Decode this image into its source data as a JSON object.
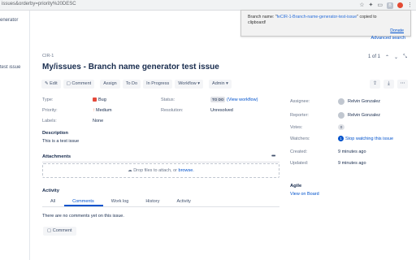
{
  "browser": {
    "url": "issues&orderby=priority%20DESC",
    "ext_icons": [
      "star-icon",
      "extensions-icon",
      "cast-icon",
      "branch-extension-icon",
      "red-extension-icon",
      "menu-icon"
    ]
  },
  "sidebar_partial": {
    "app_name": "enerator",
    "selected_issue": "test issue"
  },
  "popup": {
    "message_prefix": "Branch name: \"",
    "branch_name": "feCIR-1-Branch-name-generator-test-issue",
    "message_suffix": "\" copied to clipboard!",
    "donate": "Donate"
  },
  "header": {
    "advanced_search": "Advanced search",
    "breadcrumb": "CIR-1",
    "pager": "1 of 1",
    "title": "My/issues - Branch name generator test issue"
  },
  "toolbar": {
    "edit": "Edit",
    "comment": "Comment",
    "assign": "Assign",
    "todo": "To Do",
    "in_progress": "In Progress",
    "workflow": "Workflow",
    "admin": "Admin"
  },
  "details": {
    "type_label": "Type:",
    "type_value": "Bug",
    "priority_label": "Priority:",
    "priority_value": "Medium",
    "labels_label": "Labels:",
    "labels_value": "None",
    "status_label": "Status:",
    "status_value": "TO DO",
    "status_link": "(View workflow)",
    "resolution_label": "Resolution:",
    "resolution_value": "Unresolved"
  },
  "people": {
    "assignee_label": "Assignee:",
    "assignee": "Relvin Gonzalez",
    "reporter_label": "Reporter:",
    "reporter": "Relvin Gonzalez",
    "votes_label": "Votes:",
    "votes": "0",
    "watchers_label": "Watchers:",
    "watchers_count": "1",
    "watch_link": "Stop watching this issue"
  },
  "dates": {
    "created_label": "Created:",
    "created": "9 minutes ago",
    "updated_label": "Updated:",
    "updated": "9 minutes ago"
  },
  "agile": {
    "heading": "Agile",
    "link": "View on Board"
  },
  "description": {
    "heading": "Description",
    "text": "This is a test issue"
  },
  "attachments": {
    "heading": "Attachments",
    "drop_text": "Drop files to attach, or ",
    "browse": "browse."
  },
  "activity": {
    "heading": "Activity",
    "tabs": [
      "All",
      "Comments",
      "Work log",
      "History",
      "Activity"
    ],
    "empty": "There are no comments yet on this issue.",
    "comment_button": "Comment"
  }
}
